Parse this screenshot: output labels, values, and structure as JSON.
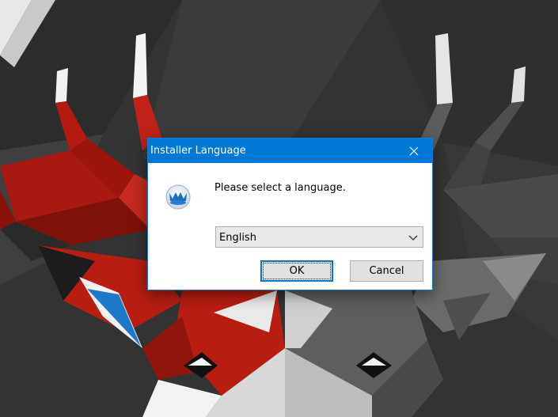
{
  "desktop": {
    "wallpaper_icon": "low-poly-deer-wallpaper"
  },
  "dialog": {
    "title": "Installer Language",
    "close_icon": "close-icon",
    "app_icon": "installer-icon",
    "prompt": "Please select a language.",
    "language_select": {
      "selected": "English"
    },
    "buttons": {
      "ok": "OK",
      "cancel": "Cancel"
    }
  },
  "colors": {
    "titlebar": "#0078d7",
    "accent": "#1f79c9",
    "deer_red": "#b81d12",
    "deer_gray": "#5a5a5a",
    "background": "#3a3a3a"
  }
}
